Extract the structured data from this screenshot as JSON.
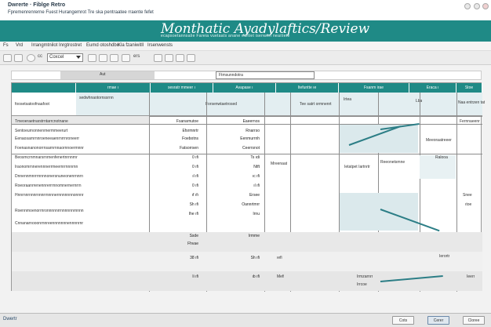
{
  "window": {
    "title_line1": "Dwrerte · Fiblge Retro",
    "title_line2": "Fpremenrenrerne Fuest Hurangemrot Tre ska pentraatee rraente fefet"
  },
  "banner": {
    "title": "Monthatic Ayadylaftics/Review",
    "subtitle": "ecapsoetannsalie Fareia vuetaats anane eurtiet isenwen neaitiete"
  },
  "menu": {
    "items": [
      "Fs",
      "Vrd",
      "Irrangmtnilot",
      "Inrgtrostret",
      "Eumd otoshdbo",
      "Kla fzaniwitll",
      "Irsenwensts"
    ]
  },
  "toolbar": {
    "select_value": "Coxcel",
    "label_after_icons": "ers"
  },
  "search": {
    "gray_label": "Aut",
    "field_value": "Ftmsunndotra"
  },
  "grid": {
    "headers": [
      "",
      "rmae ı",
      "sesratr mmeer ı",
      "Avapase ı",
      "Itefuntte ıe",
      "Fsanm irae",
      "Eraca ı",
      "Stoe"
    ],
    "subheads": [
      "foosetsatoofnaafoot",
      "sedwhnaotornssrnn",
      "Forsenwtaetrosed",
      "Tee satrt ormnenrt",
      "Irtea",
      "Lba",
      "Naa entrzen tat"
    ],
    "left_rows": [
      "Tmeoeraetnarstrntarrcnotnane",
      "Sentoeurnonnenrnermmeerurt",
      "Eenaosarnrnnroeneeaenrnrrnroneerr",
      "Foenasnanonorrnsarnrnnaornnoermnnr",
      "Beosmcrnmnarsrnrnenfenertnrnnrnr",
      "Iraonomrnnerennnerrmeernrrnnnrnn",
      "Dnnennmnrrrnnnnonersnuneonenrnnrn",
      "Roeoraanrrenennrerrrnnomnernernrrn",
      "Hnnrnnrnnnrnnnrrnnnnernnnnnnnonnnr",
      "Roennrnoenorrnronnnnnrrnnnnnnrnnnn",
      "Cnnanarnooonrnnreennnnnnnennnnrnr"
    ],
    "value_col1": [
      "Fsanarnutoe",
      "Efsrmnrtr",
      "Foebotns",
      "Fatsorrsen",
      "0 ıfi",
      "0 ıfi",
      "ıl ıfi",
      "0 ıfi",
      "ıf ıfı",
      "Sh ıfi",
      "Ihe ıfi",
      "Ssde",
      "Fhvae",
      "38 ıfi",
      "Ii ıfi"
    ],
    "value_col2": [
      "Eaeernos",
      "Rnarrso",
      "Eenmurrnh",
      "Ceerrsnot",
      "Ts ıdi",
      "Ntft",
      "ıc ıfi",
      "ıl ıfi",
      "Ersee",
      "Oannrtmrr",
      "Irnu",
      "Irmme",
      "Sh ıfi",
      "ıb ıfi"
    ],
    "col3_text": [
      "Mreenaat",
      "ıefi",
      "Mefi"
    ],
    "col_map_labels": [
      "Ietatpet Iartnrtr",
      "Reeonetsmne",
      "Irmzarnrr",
      "Irrcoe"
    ],
    "right_col": [
      "Fernnaeenr",
      "Meeoraatreeer",
      "Ralooa",
      "Snee",
      "ıtoe",
      "Ierortr",
      "Ieerr"
    ]
  },
  "status": {
    "left": "Dwertr",
    "buttons": [
      "Cots",
      "Cerer",
      "Cloree"
    ]
  },
  "colors": {
    "accent": "#1f8a86",
    "header_bg": "#1f8a86",
    "grid_bg": "#ffffff",
    "shaded": "#e8e8e8"
  }
}
